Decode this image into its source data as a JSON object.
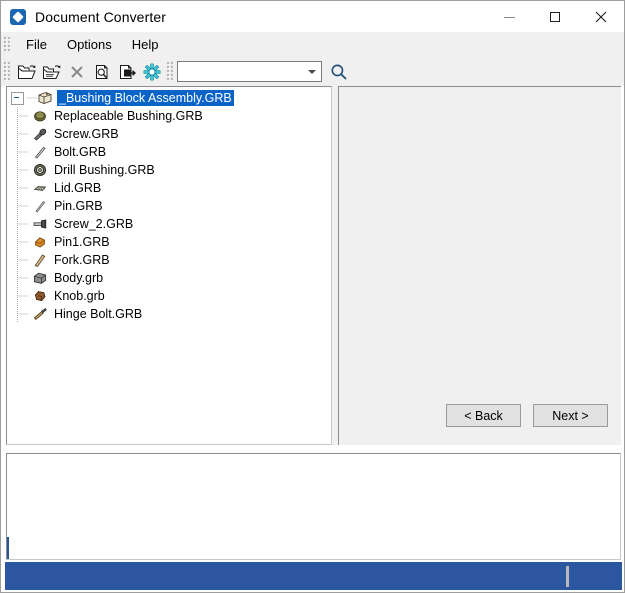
{
  "window": {
    "title": "Document Converter",
    "app_icon": "document-converter-icon",
    "minimize_label": "Minimize",
    "maximize_label": "Maximize",
    "close_label": "Close"
  },
  "menu": {
    "items": [
      {
        "label": "File",
        "name": "menu-file"
      },
      {
        "label": "Options",
        "name": "menu-options"
      },
      {
        "label": "Help",
        "name": "menu-help"
      }
    ]
  },
  "toolbar": {
    "buttons": [
      {
        "icon": "open-folder-icon",
        "label": "Open"
      },
      {
        "icon": "open-folder-multiple-icon",
        "label": "Open Multiple"
      },
      {
        "icon": "close-x-icon",
        "label": "Remove"
      },
      {
        "icon": "preview-document-icon",
        "label": "Preview"
      },
      {
        "icon": "export-document-icon",
        "label": "Export"
      },
      {
        "icon": "gear-settings-icon",
        "label": "Settings"
      }
    ],
    "search": {
      "value": "",
      "placeholder": "",
      "dropdown_icon": "chevron-down-icon",
      "search_icon": "magnifier-icon"
    }
  },
  "tree": {
    "root": {
      "label": "_Bushing Block Assembly.GRB",
      "icon": "assembly-icon",
      "expanded": true,
      "selected": true
    },
    "children": [
      {
        "label": "Replaceable Bushing.GRB",
        "icon": "bushing-part-icon"
      },
      {
        "label": "Screw.GRB",
        "icon": "screw-part-icon"
      },
      {
        "label": "Bolt.GRB",
        "icon": "bolt-part-icon"
      },
      {
        "label": "Drill Bushing.GRB",
        "icon": "drill-bushing-part-icon"
      },
      {
        "label": "Lid.GRB",
        "icon": "lid-part-icon"
      },
      {
        "label": "Pin.GRB",
        "icon": "pin-part-icon"
      },
      {
        "label": "Screw_2.GRB",
        "icon": "screw2-part-icon"
      },
      {
        "label": "Pin1.GRB",
        "icon": "pin1-part-icon"
      },
      {
        "label": "Fork.GRB",
        "icon": "fork-part-icon"
      },
      {
        "label": "Body.grb",
        "icon": "body-part-icon"
      },
      {
        "label": "Knob.grb",
        "icon": "knob-part-icon"
      },
      {
        "label": "Hinge Bolt.GRB",
        "icon": "hinge-bolt-part-icon"
      }
    ]
  },
  "wizard": {
    "back_label": "< Back",
    "next_label": "Next >"
  },
  "log": {
    "text": ""
  },
  "status": {
    "text": ""
  },
  "colors": {
    "selection": "#0a64c8",
    "status_bar": "#2d56a0",
    "toolbar_bg": "#f0f0f0",
    "panel_bg": "#f0f0f0"
  }
}
